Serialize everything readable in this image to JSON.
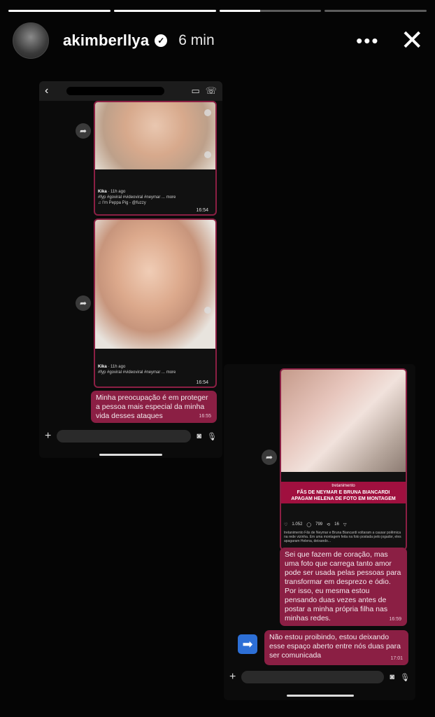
{
  "story": {
    "username": "akimberllya",
    "time_ago": "6 min",
    "progress": [
      1,
      1,
      0.4,
      0
    ],
    "icons": {
      "more": "more-horizontal-icon",
      "close": "close-icon",
      "verified": "verified-badge-icon"
    }
  },
  "left_chat": {
    "media1": {
      "user": "Kika",
      "time": "11h ago",
      "tags": "#fyp #goviral #videoviral #neymar ... more",
      "sound": "♫ I'm Peppa Pig - @fuzzy",
      "stamp": "16:54"
    },
    "media2": {
      "user": "Kika",
      "time": "11h ago",
      "tags": "#fyp #goviral #videoviral #neymar ... more",
      "stamp": "16:54"
    },
    "message": {
      "text": "Minha preocupação é em proteger a pessoa mais especial da minha vida desses ataques",
      "stamp": "16:55"
    }
  },
  "right_chat": {
    "news": {
      "brand": "tretanimento",
      "headline_line1": "FÃS DE NEYMAR E BRUNA BIANCARDI",
      "headline_line2": "APAGAM HELENA DE FOTO EM MONTAGEM",
      "likes": "1.052",
      "comments": "799",
      "shares": "16",
      "caption": "tretanimento Fãs de Neymar e Bruna Biancardi voltaram a causar polêmica na rede vizinha. Em uma montagem feita na foto postada pelo jogador, eles apagaram Helena, deixando..."
    },
    "message1": {
      "text": "Sei que fazem de coração, mas uma foto que carrega tanto amor pode ser usada pelas pessoas para transformar em desprezo e ódio. Por isso, eu mesma estou pensando duas vezes antes de postar a minha própria filha nas minhas redes.",
      "stamp": "16:59"
    },
    "message2": {
      "text": "Não estou proibindo, estou deixando esse espaço aberto entre nós duas para ser comunicada",
      "stamp": "17:01"
    }
  },
  "colors": {
    "bubble": "#8b1f44",
    "background": "#000000",
    "accent": "#2d6fd6"
  }
}
